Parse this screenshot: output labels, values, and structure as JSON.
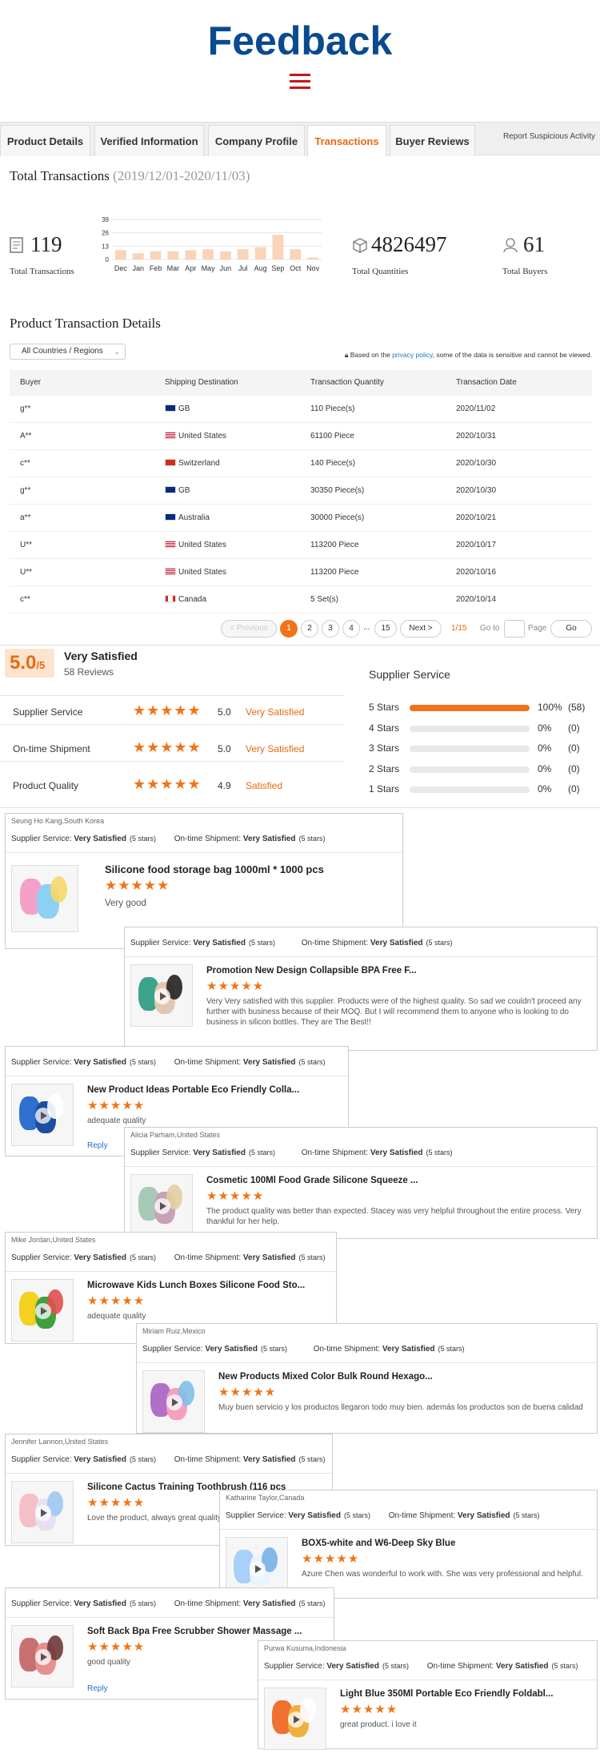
{
  "header": {
    "title": "Feedback"
  },
  "tabs": [
    "Product Details",
    "Verified Information",
    "Company Profile",
    "Transactions",
    "Buyer Reviews"
  ],
  "report": "Report Suspicious Activity",
  "total": {
    "label": "Total Transactions",
    "range": "(2019/12/01-2020/11/03)"
  },
  "stats": {
    "transactions": "119",
    "transactions_label": "Total Transactions",
    "quantities": "4826497",
    "quantities_label": "Total Quantities",
    "buyers": "61",
    "buyers_label": "Total Buyers"
  },
  "chart_data": {
    "type": "bar",
    "categories": [
      "Dec",
      "Jan",
      "Feb",
      "Mar",
      "Apr",
      "May",
      "Jun",
      "Jul",
      "Aug",
      "Sep",
      "Oct",
      "Nov"
    ],
    "values": [
      9,
      6,
      8,
      8,
      9,
      10,
      8,
      10,
      12,
      24,
      10,
      2
    ],
    "yticks": [
      "39",
      "26",
      "13",
      "0"
    ],
    "ylim": [
      0,
      39
    ]
  },
  "details": {
    "title": "Product Transaction Details",
    "filter": "All Countries / Regions",
    "privacy_pre": "Based on the ",
    "privacy_link": "privacy policy",
    "privacy_post": ", some of the data is sensitive and cannot be viewed."
  },
  "table": {
    "headers": [
      "Buyer",
      "Shipping Destination",
      "Transaction Quantity",
      "Transaction Date"
    ],
    "rows": [
      {
        "buyer": "g**",
        "dest": "GB",
        "flag": "gb",
        "qty": "110 Piece(s)",
        "date": "2020/11/02"
      },
      {
        "buyer": "A**",
        "dest": "United States",
        "flag": "us",
        "qty": "61100 Piece",
        "date": "2020/10/31"
      },
      {
        "buyer": "c**",
        "dest": "Switzerland",
        "flag": "ch",
        "qty": "140 Piece(s)",
        "date": "2020/10/30"
      },
      {
        "buyer": "g**",
        "dest": "GB",
        "flag": "gb",
        "qty": "30350 Piece(s)",
        "date": "2020/10/30"
      },
      {
        "buyer": "a**",
        "dest": "Australia",
        "flag": "au",
        "qty": "30000 Piece(s)",
        "date": "2020/10/21"
      },
      {
        "buyer": "U**",
        "dest": "United States",
        "flag": "us",
        "qty": "113200 Piece",
        "date": "2020/10/17"
      },
      {
        "buyer": "U**",
        "dest": "United States",
        "flag": "us",
        "qty": "113200 Piece",
        "date": "2020/10/16"
      },
      {
        "buyer": "c**",
        "dest": "Canada",
        "flag": "ca",
        "qty": "5 Set(s)",
        "date": "2020/10/14"
      }
    ]
  },
  "pagination": {
    "prev": "< Previous",
    "pages": [
      "1",
      "2",
      "3",
      "4",
      "...",
      "15"
    ],
    "next": "Next >",
    "count": "1/15",
    "goto": "Go to",
    "page": "Page",
    "go": "Go"
  },
  "rating": {
    "score": "5.0",
    "outof": "/5",
    "label": "Very Satisfied",
    "reviews": "58 Reviews",
    "items": [
      {
        "label": "Supplier Service",
        "value": "5.0",
        "text": "Very Satisfied"
      },
      {
        "label": "On-time Shipment",
        "value": "5.0",
        "text": "Very Satisfied"
      },
      {
        "label": "Product Quality",
        "value": "4.9",
        "text": "Satisfied"
      }
    ],
    "supplier_title": "Supplier Service",
    "breakdown": [
      {
        "label": "5 Stars",
        "pct": "100%",
        "n": "(58)",
        "fill": 1.0
      },
      {
        "label": "4 Stars",
        "pct": "0%",
        "n": "(0)",
        "fill": 0
      },
      {
        "label": "3 Stars",
        "pct": "0%",
        "n": "(0)",
        "fill": 0
      },
      {
        "label": "2 Stars",
        "pct": "0%",
        "n": "(0)",
        "fill": 0
      },
      {
        "label": "1 Stars",
        "pct": "0%",
        "n": "(0)",
        "fill": 0
      }
    ]
  },
  "review_common": {
    "ss": "Supplier Service:",
    "vs": "Very Satisfied",
    "five": "(5 stars)",
    "os": "On-time Shipment:",
    "stars": "★★★★★",
    "reply": "Reply"
  },
  "reviews": [
    {
      "who": "Seung Ho Kang,South Korea",
      "product": "Silicone food storage bag 1000ml * 1000 pcs",
      "comment": "Very good"
    },
    {
      "who": "",
      "product": "Promotion New Design Collapsible BPA Free F...",
      "comment": "Very Very satisfied with this supplier. Products were of the highest quality. So sad we couldn't proceed any further with business because of their MOQ. But I will recommend them to anyone who is looking to do business in silicon bottles. They are The Best!!"
    },
    {
      "who": "",
      "product": "New Product Ideas Portable Eco Friendly Colla...",
      "comment": "adequate quality"
    },
    {
      "who": "Alicia Parham,United States",
      "product": "Cosmetic 100Ml Food Grade Silicone Squeeze ...",
      "comment": "The product quality was better than expected.  Stacey was very helpful throughout the entire process.  Very thankful for her help."
    },
    {
      "who": "Mike Jordan,United States",
      "product": "Microwave Kids Lunch Boxes Silicone Food Sto...",
      "comment": "adequate quality"
    },
    {
      "who": "Miriam Ruiz,Mexico",
      "product": "New Products Mixed Color Bulk Round Hexago...",
      "comment": "Muy buen servicio y los productos llegaron todo muy bien. además los productos son de buena calidad"
    },
    {
      "who": "Jennifer Lannon,United States",
      "product": "Silicone Cactus Training Toothbrush (116 pcs",
      "comment": "Love the product, always great quality"
    },
    {
      "who": "Katharine Taylor,Canada",
      "product": "BOX5-white and W6-Deep Sky Blue",
      "comment": "Azure Chen was wonderful to work with. She was very professional and helpful."
    },
    {
      "who": "",
      "product": "Soft Back Bpa Free Scrubber Shower Massage ...",
      "comment": "good quality"
    },
    {
      "who": "Purwa Kusuma,Indonesia",
      "product": "Light Blue 350Ml Portable Eco Friendly Foldabl...",
      "comment": "great product. i love it"
    }
  ]
}
